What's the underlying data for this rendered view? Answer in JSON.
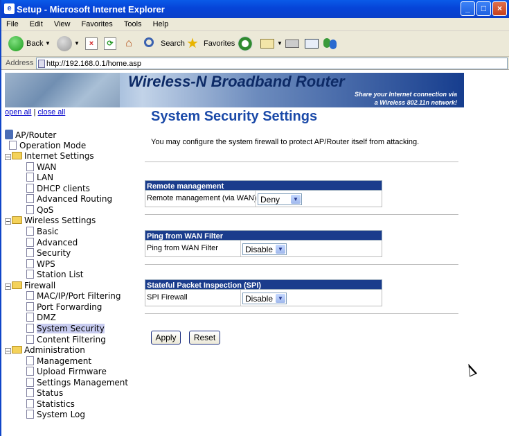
{
  "window": {
    "title": "Setup - Microsoft Internet Explorer"
  },
  "menu": [
    "File",
    "Edit",
    "View",
    "Favorites",
    "Tools",
    "Help"
  ],
  "toolbar": {
    "back": "Back",
    "search": "Search",
    "favorites": "Favorites"
  },
  "address": {
    "label": "Address",
    "url": "http://192.168.0.1/home.asp"
  },
  "banner": {
    "title": "Wireless-N Broadband Router",
    "tagline1": "Share your Internet connection via",
    "tagline2": "a Wireless 802.11n network!"
  },
  "links": {
    "open_all": "open all",
    "separator": "|",
    "close_all": "close all"
  },
  "tree": {
    "root": "AP/Router",
    "operation_mode": "Operation Mode",
    "internet": "Internet Settings",
    "wan": "WAN",
    "lan": "LAN",
    "dhcp": "DHCP clients",
    "adv_routing": "Advanced Routing",
    "qos": "QoS",
    "wireless": "Wireless Settings",
    "basic": "Basic",
    "advanced": "Advanced",
    "security": "Security",
    "wps": "WPS",
    "station_list": "Station List",
    "firewall": "Firewall",
    "mac_filter": "MAC/IP/Port Filtering",
    "port_fwd": "Port Forwarding",
    "dmz": "DMZ",
    "system_security": "System Security",
    "content_filter": "Content Filtering",
    "administration": "Administration",
    "management": "Management",
    "upload_fw": "Upload Firmware",
    "settings_mgmt": "Settings Management",
    "status": "Status",
    "statistics": "Statistics",
    "system_log": "System Log"
  },
  "page": {
    "title": "System Security Settings",
    "description": "You may configure the system firewall to protect AP/Router itself from attacking."
  },
  "remote": {
    "header": "Remote management",
    "label": "Remote management (via WAN)",
    "value": "Deny"
  },
  "ping": {
    "header": "Ping from WAN Filter",
    "label": "Ping from WAN Filter",
    "value": "Disable"
  },
  "spi": {
    "header": "Stateful Packet Inspection (SPI)",
    "label": "SPI Firewall",
    "value": "Disable"
  },
  "buttons": {
    "apply": "Apply",
    "reset": "Reset"
  }
}
